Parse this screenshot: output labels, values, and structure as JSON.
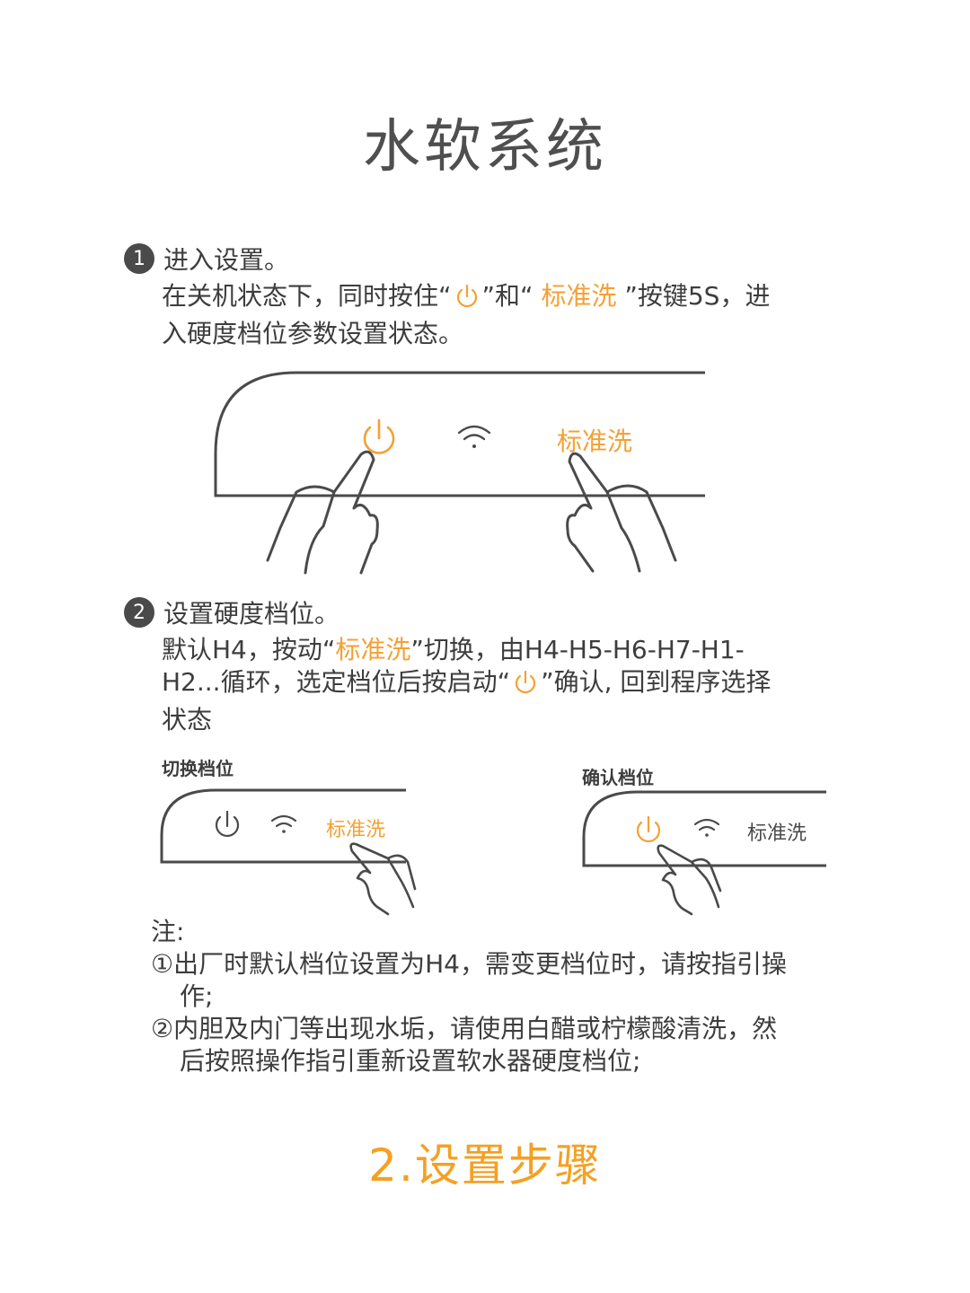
{
  "title": "水软系统",
  "colors": {
    "accent": "#f5a033",
    "text": "#3d3d3d",
    "line": "#4a4a4a"
  },
  "step1": {
    "number": "1",
    "heading": "进入设置。",
    "line1_a": "在关机状态下，同时按住“",
    "line1_b": "”和“ ",
    "line1_orange": "标准洗",
    "line1_c": " ”按键5S，进",
    "line2": "入硬度档位参数设置状态。"
  },
  "panel_main": {
    "power_icon": "power-icon",
    "wifi_icon": "wifi-icon",
    "wash_label": "标准洗"
  },
  "step2": {
    "number": "2",
    "heading": "设置硬度档位。",
    "line1_a": "默认H4，按动“",
    "line1_orange": "标准洗",
    "line1_b": "”切换，由H4-H5-H6-H7-H1-",
    "line2_a": "H2...循环，选定档位后按启动“",
    "line2_b": "”确认, 回到程序选择",
    "line3": "状态"
  },
  "panel_switch": {
    "label": "切换档位",
    "wash_label": "标准洗"
  },
  "panel_confirm": {
    "label": "确认档位",
    "wash_label": "标准洗"
  },
  "notes": {
    "heading": "注:",
    "items": [
      {
        "marker": "①",
        "line1": "出厂时默认档位设置为H4，需变更档位时，请按指引操",
        "line2": "作;"
      },
      {
        "marker": "②",
        "line1": "内胆及内门等出现水垢，请使用白醋或柠檬酸清洗，然",
        "line2": "后按照操作指引重新设置软水器硬度档位;"
      }
    ]
  },
  "footer_title": "2.设置步骤"
}
